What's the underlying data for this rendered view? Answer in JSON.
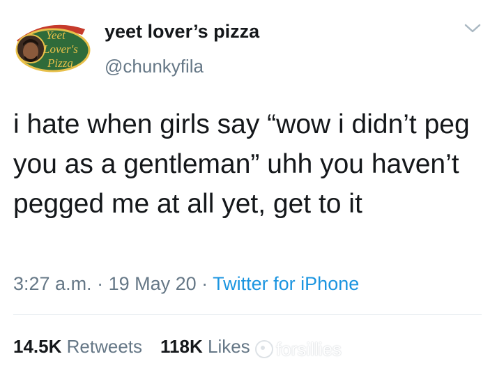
{
  "author": {
    "display_name": "yeet lover’s pizza",
    "handle": "@chunkyfila",
    "avatar_text_lines": [
      "Yeet",
      "Lover's",
      "Pizza"
    ]
  },
  "tweet": {
    "text": "i hate when girls say “wow i didn’t peg you as a gentleman” uhh you haven’t pegged me at all yet, get to it"
  },
  "meta": {
    "time": "3:27 a.m.",
    "separator1": " · ",
    "date": "19 May 20",
    "separator2": " · ",
    "source": "Twitter for iPhone"
  },
  "stats": {
    "retweets_count": "14.5K",
    "retweets_label": "Retweets",
    "likes_count": "118K",
    "likes_label": "Likes"
  },
  "watermark": {
    "text": "forsillies"
  },
  "icons": {
    "menu": "chevron-down-icon",
    "watermark": "weibo-logo-icon"
  },
  "colors": {
    "text": "#14171a",
    "secondary": "#657786",
    "link": "#1b95e0",
    "divider": "#e6ecf0",
    "logo_green": "#2f6b3a",
    "logo_gold": "#e8c04a"
  }
}
